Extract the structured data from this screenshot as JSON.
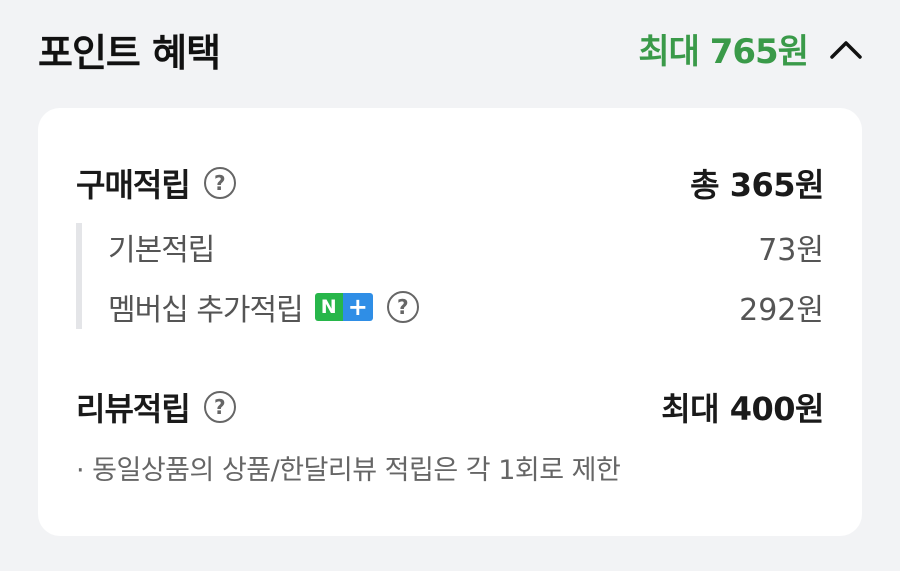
{
  "header": {
    "title": "포인트 혜택",
    "max_label": "최대 765원",
    "max_color": "#3a9a49",
    "toggle_icon": "chevron-up-icon"
  },
  "purchase": {
    "label": "구매적립",
    "help_icon": "question-circle-icon",
    "total": "총 365원",
    "items": [
      {
        "label": "기본적립",
        "value": "73원"
      },
      {
        "label": "멤버십 추가적립",
        "badge": [
          "N",
          "+"
        ],
        "value": "292원"
      }
    ]
  },
  "review": {
    "label": "리뷰적립",
    "help_icon": "question-circle-icon",
    "total": "최대 400원",
    "note": "· 동일상품의 상품/한달리뷰 적립은 각 1회로 제한"
  }
}
